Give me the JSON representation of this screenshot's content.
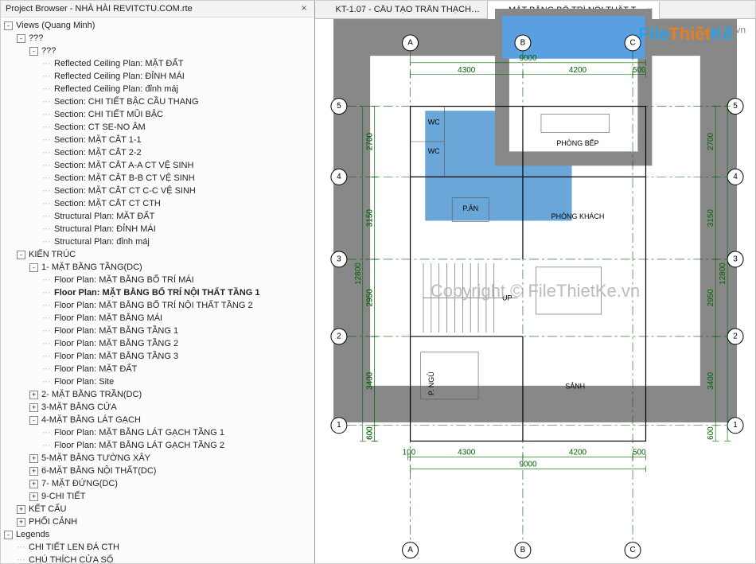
{
  "panel": {
    "title_prefix": "Project Browser - ",
    "title_file": "NHÀ HÀI REVITCTU.COM.rte",
    "root_label": "Views (Quang Minh)",
    "qmark": "???",
    "items_unnamed": [
      "Reflected Ceiling Plan: MẶT ĐẤT",
      "Reflected Ceiling Plan: ĐỈNH MÁI",
      "Reflected Ceiling Plan: đỉnh máj",
      "Section: CHI TIẾT BẬC CẦU THANG",
      "Section: CHI TIẾT MŨI BẬC",
      "Section: CT SE-NO ÂM",
      "Section: MẶT CẮT 1-1",
      "Section: MẶT CẮT 2-2",
      "Section: MẶT CẮT A-A CT VỆ SINH",
      "Section: MẶT CẮT B-B CT VỆ SINH",
      "Section: MẶT CẮT CT C-C VỆ SINH",
      "Section: MẶT CẮT CT CTH",
      "Structural Plan: MẶT ĐẤT",
      "Structural Plan: ĐỈNH MÁI",
      "Structural Plan: đỉnh máj"
    ],
    "arch_label": "KIẾN TRÚC",
    "arch_groups": [
      {
        "label": "1- MẶT BẰNG TẦNG(DC)",
        "open": true,
        "items": [
          "Floor Plan: MẶT BẰNG BỐ TRÍ MÁI",
          "Floor Plan: MẶT BẰNG BỐ TRÍ NỘI THẤT TẦNG 1",
          "Floor Plan: MẶT BẰNG BỐ TRÍ NỘI THẤT TẦNG 2",
          "Floor Plan: MẶT BẰNG MÁI",
          "Floor Plan: MẶT BẰNG TẦNG 1",
          "Floor Plan: MẶT BẰNG TẦNG 2",
          "Floor Plan: MẶT BẰNG TẦNG 3",
          "Floor Plan: MẶT ĐẤT",
          "Floor Plan: Site"
        ],
        "selected_index": 1
      },
      {
        "label": "2- MẶT BẰNG TRẦN(DC)",
        "open": false
      },
      {
        "label": "3-MẶT BẰNG CỬA",
        "open": false
      },
      {
        "label": "4-MẶT BẰNG LÁT GẠCH",
        "open": true,
        "items": [
          "Floor Plan: MẶT BẰNG LÁT GẠCH TẦNG 1",
          "Floor Plan: MẶT BẰNG LÁT GẠCH TẦNG 2"
        ]
      },
      {
        "label": "5-MẶT BẰNG TƯỜNG XÂY",
        "open": false
      },
      {
        "label": "6-MẶT BẰNG NỘI THẤT(DC)",
        "open": false
      },
      {
        "label": "7-   MẶT ĐỨNG(DC)",
        "open": false
      },
      {
        "label": "9-CHI TIẾT",
        "open": false
      }
    ],
    "other_groups": [
      {
        "label": "KẾT CẤU",
        "open": false
      },
      {
        "label": "PHỐI CẢNH",
        "open": false
      }
    ],
    "legends_label": "Legends",
    "legends_items": [
      "CHI TIẾT LEN ĐÁ CTH",
      "CHÚ THÍCH CỬA SỔ"
    ]
  },
  "tabs": {
    "inactive": "KT-1.07 - CẤU TẠO TRẦN THẠCH C...",
    "active": "MẶT BẰNG BỐ TRÍ NỘI THẤT T..."
  },
  "logo": {
    "a": "File",
    "b": "Thiết",
    "c": "Kế",
    "d": ".vn"
  },
  "watermark": "Copyright © FileThietKe.vn",
  "plan": {
    "grids_h": [
      "A",
      "B",
      "C"
    ],
    "grids_v": [
      "1",
      "2",
      "3",
      "4",
      "5"
    ],
    "dims_top": [
      "4300",
      "4200",
      "500"
    ],
    "dim_top_total": "9000",
    "dims_left": [
      "600",
      "3400",
      "2950",
      "3150",
      "2700"
    ],
    "dim_left_total": "12800",
    "dims_bottom": [
      "100",
      "4300",
      "4200",
      "500"
    ],
    "dim_bottom_total": "9000",
    "rooms": {
      "wc1": "WC",
      "wc2": "WC",
      "kitchen": "PHÒNG BẾP",
      "dining": "P.ĂN",
      "living": "PHÒNG KHÁCH",
      "up": "UP",
      "bed": "P. NGỦ",
      "hall": "SẢNH"
    }
  }
}
